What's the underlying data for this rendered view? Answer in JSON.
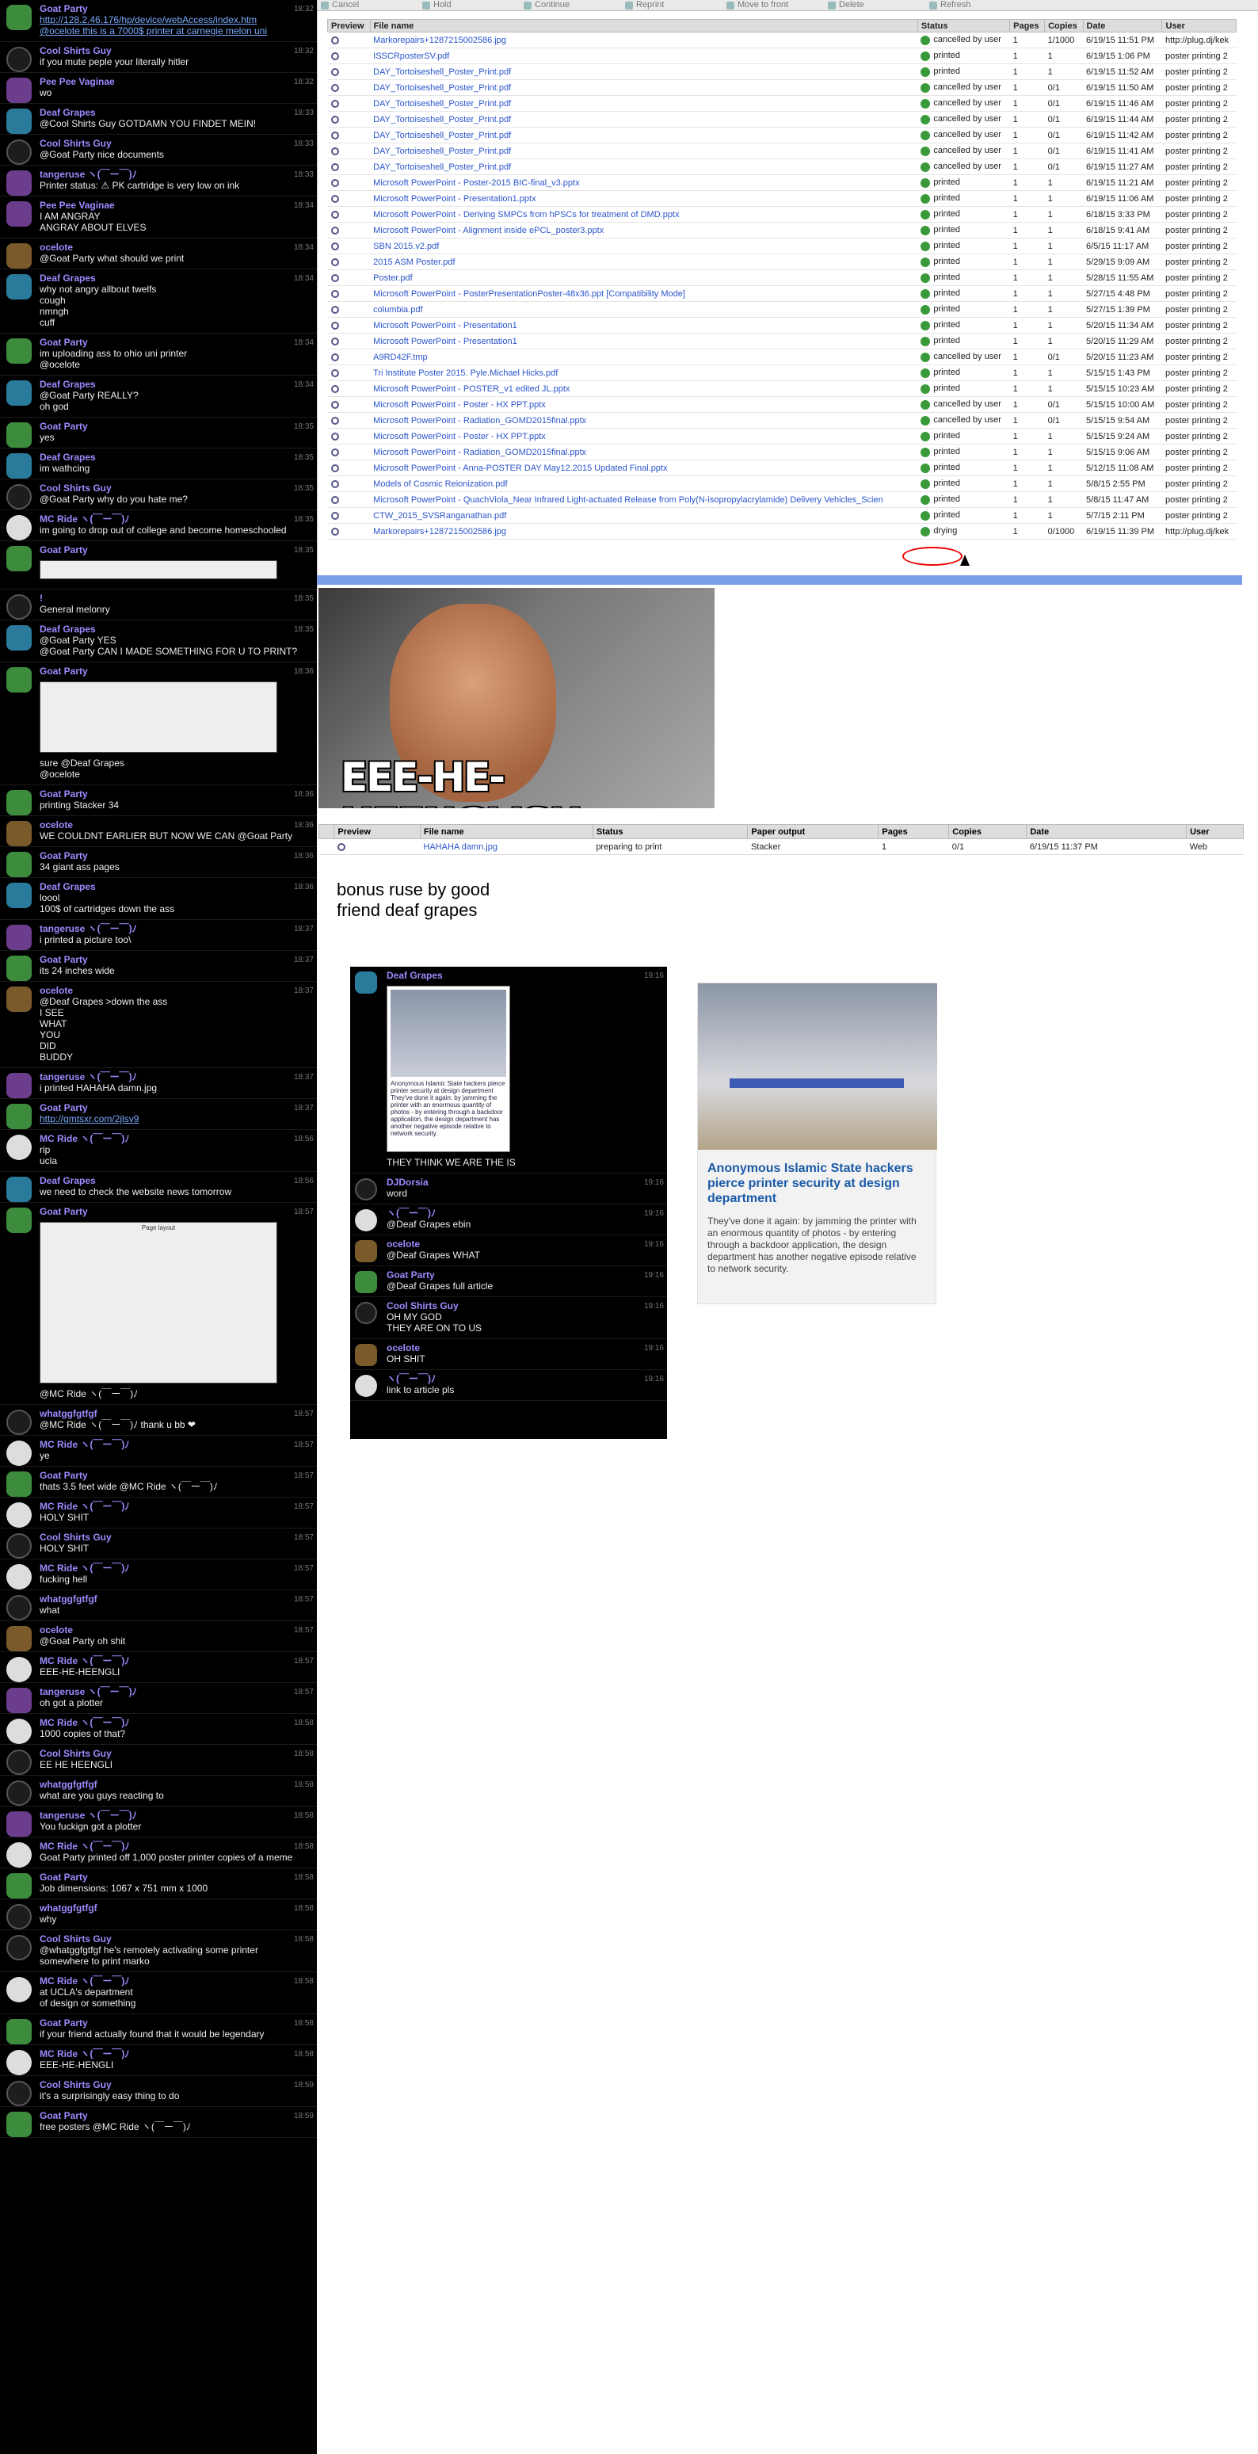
{
  "chat_messages": [
    {
      "user": "Goat Party",
      "time": "18:32",
      "text": "http://128.2.46.176/hp/device/webAccess/index.htm\n@ocelote this is a 7000$ printer at carnegie melon uni",
      "av": "c1"
    },
    {
      "user": "Cool Shirts Guy",
      "time": "18:32",
      "text": "if you mute peple your literally hitler",
      "av": "c4"
    },
    {
      "user": "Pee Pee Vaginae",
      "time": "18:32",
      "text": "wo",
      "av": "c3"
    },
    {
      "user": "Deaf Grapes",
      "time": "18:33",
      "text": "@Cool Shirts Guy GOTDAMN YOU FINDET MEIN!",
      "av": "c2"
    },
    {
      "user": "Cool Shirts Guy",
      "time": "18:33",
      "text": "@Goat Party nice documents",
      "av": "c4"
    },
    {
      "user": "tangeruse ヽ(￣ー￣)ﾉ",
      "time": "18:33",
      "text": "Printer status: ⚠ PK cartridge is very low on ink",
      "av": "c3"
    },
    {
      "user": "Pee Pee Vaginae",
      "time": "18:34",
      "text": "I AM ANGRAY\nANGRAY ABOUT ELVES",
      "av": "c3"
    },
    {
      "user": "ocelote",
      "time": "18:34",
      "text": "@Goat Party what should we print",
      "av": "c6"
    },
    {
      "user": "Deaf Grapes",
      "time": "18:34",
      "text": "why not angry allbout twelfs\ncough\nnmngh\ncuff",
      "av": "c2"
    },
    {
      "user": "Goat Party",
      "time": "18:34",
      "text": "im uploading ass to ohio uni printer\n@ocelote",
      "av": "c1"
    },
    {
      "user": "Deaf Grapes",
      "time": "18:34",
      "text": "@Goat Party REALLY?\noh god",
      "av": "c2"
    },
    {
      "user": "Goat Party",
      "time": "18:35",
      "text": "yes",
      "av": "c1"
    },
    {
      "user": "Deaf Grapes",
      "time": "18:35",
      "text": "im wathcing",
      "av": "c2"
    },
    {
      "user": "Cool Shirts Guy",
      "time": "18:35",
      "text": "@Goat Party why do you hate me?",
      "av": "c4"
    },
    {
      "user": "MC Ride ヽ(￣ー￣)ﾉ",
      "time": "18:35",
      "text": "im going to drop out of college and become homeschooled",
      "av": "c5"
    },
    {
      "user": "Goat Party",
      "time": "18:35",
      "text": "",
      "av": "c1",
      "img": 24
    },
    {
      "user": "!",
      "time": "18:35",
      "text": "General melonry",
      "av": "c4"
    },
    {
      "user": "Deaf Grapes",
      "time": "18:35",
      "text": "@Goat Party YES\n@Goat Party CAN I MADE SOMETHING FOR U TO PRINT?",
      "av": "c2"
    },
    {
      "user": "Goat Party",
      "time": "18:36",
      "text": "sure @Deaf Grapes\n@ocelote",
      "av": "c1",
      "img": 90
    },
    {
      "user": "Goat Party",
      "time": "18:36",
      "text": "printing Stacker 34",
      "av": "c1"
    },
    {
      "user": "ocelote",
      "time": "18:36",
      "text": "WE COULDNT EARLIER BUT NOW WE CAN @Goat Party",
      "av": "c6"
    },
    {
      "user": "Goat Party",
      "time": "18:36",
      "text": "34 giant ass pages",
      "av": "c1"
    },
    {
      "user": "Deaf Grapes",
      "time": "18:36",
      "text": "loool\n100$ of cartridges down the ass",
      "av": "c2"
    },
    {
      "user": "tangeruse ヽ(￣ー￣)ﾉ",
      "time": "18:37",
      "text": "i printed a picture too\\",
      "av": "c3"
    },
    {
      "user": "Goat Party",
      "time": "18:37",
      "text": "its 24 inches wide",
      "av": "c1"
    },
    {
      "user": "ocelote",
      "time": "18:37",
      "text": "@Deaf Grapes >down the ass\nI SEE\nWHAT\nYOU\nDID\nBUDDY",
      "av": "c6"
    },
    {
      "user": "tangeruse ヽ(￣ー￣)ﾉ",
      "time": "18:37",
      "text": "i printed HAHAHA damn.jpg",
      "av": "c3"
    },
    {
      "user": "Goat Party",
      "time": "18:37",
      "text": "http://gmtsxr.com/2jlsv9",
      "av": "c1"
    },
    {
      "user": "MC Ride ヽ(￣ー￣)ﾉ",
      "time": "18:56",
      "text": "rip\nucla",
      "av": "c5"
    },
    {
      "user": "Deaf Grapes",
      "time": "18:56",
      "text": "we need to check the website news tomorrow",
      "av": "c2"
    },
    {
      "user": "Goat Party",
      "time": "18:57",
      "text": "@MC Ride ヽ(￣ー￣)ﾉ",
      "av": "c1",
      "img": 204,
      "imgcap": "Page layout"
    },
    {
      "user": "whatggfgtfgf",
      "time": "18:57",
      "text": "@MC Ride ヽ(￣ー￣)ﾉ thank u bb ❤",
      "av": "c4"
    },
    {
      "user": "MC Ride ヽ(￣ー￣)ﾉ",
      "time": "18:57",
      "text": "ye",
      "av": "c5"
    },
    {
      "user": "Goat Party",
      "time": "18:57",
      "text": "thats 3.5 feet wide @MC Ride ヽ(￣ー￣)ﾉ",
      "av": "c1"
    },
    {
      "user": "MC Ride ヽ(￣ー￣)ﾉ",
      "time": "18:57",
      "text": "HOLY SHIT",
      "av": "c5"
    },
    {
      "user": "Cool Shirts Guy",
      "time": "18:57",
      "text": "HOLY SHIT",
      "av": "c4"
    },
    {
      "user": "MC Ride ヽ(￣ー￣)ﾉ",
      "time": "18:57",
      "text": "fucking hell",
      "av": "c5"
    },
    {
      "user": "whatggfgtfgf",
      "time": "18:57",
      "text": "what",
      "av": "c4"
    },
    {
      "user": "ocelote",
      "time": "18:57",
      "text": "@Goat Party oh shit",
      "av": "c6"
    },
    {
      "user": "MC Ride ヽ(￣ー￣)ﾉ",
      "time": "18:57",
      "text": "EEE-HE-HEENGLI",
      "av": "c5"
    },
    {
      "user": "tangeruse ヽ(￣ー￣)ﾉ",
      "time": "18:57",
      "text": "oh got a plotter",
      "av": "c3"
    },
    {
      "user": "MC Ride ヽ(￣ー￣)ﾉ",
      "time": "18:58",
      "text": "1000 copies of that?",
      "av": "c5"
    },
    {
      "user": "Cool Shirts Guy",
      "time": "18:58",
      "text": "EE HE HEENGLI",
      "av": "c4"
    },
    {
      "user": "whatggfgtfgf",
      "time": "18:58",
      "text": "what are you guys reacting to",
      "av": "c4"
    },
    {
      "user": "tangeruse ヽ(￣ー￣)ﾉ",
      "time": "18:58",
      "text": "You fuckign got a plotter",
      "av": "c3"
    },
    {
      "user": "MC Ride ヽ(￣ー￣)ﾉ",
      "time": "18:58",
      "text": "Goat Party printed off 1,000 poster printer copies of a meme",
      "av": "c5"
    },
    {
      "user": "Goat Party",
      "time": "18:58",
      "text": "Job dimensions: 1067 x 751 mm x 1000",
      "av": "c1"
    },
    {
      "user": "whatggfgtfgf",
      "time": "18:58",
      "text": "why",
      "av": "c4"
    },
    {
      "user": "Cool Shirts Guy",
      "time": "18:58",
      "text": "@whatggfgtfgf he's remotely activating some printer\nsomewhere to print marko",
      "av": "c4"
    },
    {
      "user": "MC Ride ヽ(￣ー￣)ﾉ",
      "time": "18:58",
      "text": "at UCLA's department\nof design or something",
      "av": "c5"
    },
    {
      "user": "Goat Party",
      "time": "18:58",
      "text": "if your friend actually found that it would be legendary",
      "av": "c1"
    },
    {
      "user": "MC Ride ヽ(￣ー￣)ﾉ",
      "time": "18:58",
      "text": "EEE-HE-HENGLI",
      "av": "c5"
    },
    {
      "user": "Cool Shirts Guy",
      "time": "18:59",
      "text": "it's a surprisingly easy thing to do",
      "av": "c4"
    },
    {
      "user": "Goat Party",
      "time": "18:59",
      "text": "free posters @MC Ride ヽ(￣ー￣)ﾉ",
      "av": "c1"
    }
  ],
  "toolbar": [
    "Cancel",
    "Hold",
    "Continue",
    "Reprint",
    "Move to front",
    "Delete",
    "Refresh"
  ],
  "jobs_headers": [
    "Preview",
    "File name",
    "Status",
    "Pages",
    "Copies",
    "Date",
    "User"
  ],
  "jobs": [
    [
      "Markorepairs+1287215002586.jpg",
      "cancelled by user",
      "1",
      "1/1000",
      "6/19/15 11:51 PM",
      "http://plug.dj/kek"
    ],
    [
      "ISSCRposterSV.pdf",
      "printed",
      "1",
      "1",
      "6/19/15 1:06 PM",
      "poster printing 2"
    ],
    [
      "DAY_Tortoiseshell_Poster_Print.pdf",
      "printed",
      "1",
      "1",
      "6/19/15 11:52 AM",
      "poster printing 2"
    ],
    [
      "DAY_Tortoiseshell_Poster_Print.pdf",
      "cancelled by user",
      "1",
      "0/1",
      "6/19/15 11:50 AM",
      "poster printing 2"
    ],
    [
      "DAY_Tortoiseshell_Poster_Print.pdf",
      "cancelled by user",
      "1",
      "0/1",
      "6/19/15 11:46 AM",
      "poster printing 2"
    ],
    [
      "DAY_Tortoiseshell_Poster_Print.pdf",
      "cancelled by user",
      "1",
      "0/1",
      "6/19/15 11:44 AM",
      "poster printing 2"
    ],
    [
      "DAY_Tortoiseshell_Poster_Print.pdf",
      "cancelled by user",
      "1",
      "0/1",
      "6/19/15 11:42 AM",
      "poster printing 2"
    ],
    [
      "DAY_Tortoiseshell_Poster_Print.pdf",
      "cancelled by user",
      "1",
      "0/1",
      "6/19/15 11:41 AM",
      "poster printing 2"
    ],
    [
      "DAY_Tortoiseshell_Poster_Print.pdf",
      "cancelled by user",
      "1",
      "0/1",
      "6/19/15 11:27 AM",
      "poster printing 2"
    ],
    [
      "Microsoft PowerPoint - Poster-2015 BIC-final_v3.pptx",
      "printed",
      "1",
      "1",
      "6/19/15 11:21 AM",
      "poster printing 2"
    ],
    [
      "Microsoft PowerPoint - Presentation1.pptx",
      "printed",
      "1",
      "1",
      "6/19/15 11:06 AM",
      "poster printing 2"
    ],
    [
      "Microsoft PowerPoint - Deriving SMPCs from hPSCs for treatment of DMD.pptx",
      "printed",
      "1",
      "1",
      "6/18/15 3:33 PM",
      "poster printing 2"
    ],
    [
      "Microsoft PowerPoint - Alignment inside ePCL_poster3.pptx",
      "printed",
      "1",
      "1",
      "6/18/15 9:41 AM",
      "poster printing 2"
    ],
    [
      "SBN 2015.v2.pdf",
      "printed",
      "1",
      "1",
      "6/5/15 11:17 AM",
      "poster printing 2"
    ],
    [
      "2015 ASM Poster.pdf",
      "printed",
      "1",
      "1",
      "5/29/15 9:09 AM",
      "poster printing 2"
    ],
    [
      "Poster.pdf",
      "printed",
      "1",
      "1",
      "5/28/15 11:55 AM",
      "poster printing 2"
    ],
    [
      "Microsoft PowerPoint - PosterPresentationPoster-48x36.ppt [Compatibility Mode]",
      "printed",
      "1",
      "1",
      "5/27/15 4:48 PM",
      "poster printing 2"
    ],
    [
      "columbia.pdf",
      "printed",
      "1",
      "1",
      "5/27/15 1:39 PM",
      "poster printing 2"
    ],
    [
      "Microsoft PowerPoint - Presentation1",
      "printed",
      "1",
      "1",
      "5/20/15 11:34 AM",
      "poster printing 2"
    ],
    [
      "Microsoft PowerPoint - Presentation1",
      "printed",
      "1",
      "1",
      "5/20/15 11:29 AM",
      "poster printing 2"
    ],
    [
      "A9RD42F.tmp",
      "cancelled by user",
      "1",
      "0/1",
      "5/20/15 11:23 AM",
      "poster printing 2"
    ],
    [
      "Tri Institute Poster 2015. Pyle.Michael Hicks.pdf",
      "printed",
      "1",
      "1",
      "5/15/15 1:43 PM",
      "poster printing 2"
    ],
    [
      "Microsoft PowerPoint - POSTER_v1 edited JL.pptx",
      "printed",
      "1",
      "1",
      "5/15/15 10:23 AM",
      "poster printing 2"
    ],
    [
      "Microsoft PowerPoint - Poster - HX PPT.pptx",
      "cancelled by user",
      "1",
      "0/1",
      "5/15/15 10:00 AM",
      "poster printing 2"
    ],
    [
      "Microsoft PowerPoint - Radiation_GOMD2015final.pptx",
      "cancelled by user",
      "1",
      "0/1",
      "5/15/15 9:54 AM",
      "poster printing 2"
    ],
    [
      "Microsoft PowerPoint - Poster - HX PPT.pptx",
      "printed",
      "1",
      "1",
      "5/15/15 9:24 AM",
      "poster printing 2"
    ],
    [
      "Microsoft PowerPoint - Radiation_GOMD2015final.pptx",
      "printed",
      "1",
      "1",
      "5/15/15 9:06 AM",
      "poster printing 2"
    ],
    [
      "Microsoft PowerPoint - Anna-POSTER DAY May12.2015 Updated Final.pptx",
      "printed",
      "1",
      "1",
      "5/12/15 11:08 AM",
      "poster printing 2"
    ],
    [
      "Models of Cosmic Reionization.pdf",
      "printed",
      "1",
      "1",
      "5/8/15 2:55 PM",
      "poster printing 2"
    ],
    [
      "Microsoft PowerPoint - QuachViola_Near Infrared Light-actuated Release from Poly(N-isopropylacrylamide) Delivery Vehicles_Scien",
      "printed",
      "1",
      "1",
      "5/8/15 11:47 AM",
      "poster printing 2"
    ],
    [
      "CTW_2015_SVSRanganathan.pdf",
      "printed",
      "1",
      "1",
      "5/7/15 2:11 PM",
      "poster printing 2"
    ],
    [
      "Markorepairs+1287215002586.jpg",
      "drying",
      "1",
      "0/1000",
      "6/19/15 11:39 PM",
      "http://plug.dj/kek"
    ]
  ],
  "meme_caption": "EEE-HE-HEENGLISH",
  "queue2_headers": [
    "Preview",
    "File name",
    "Status",
    "Paper output",
    "Pages",
    "Copies",
    "Date",
    "User"
  ],
  "queue2_row": [
    "HAHAHA damn.jpg",
    "preparing to print",
    "Stacker",
    "1",
    "0/1",
    "6/19/15 11:37 PM",
    "Web"
  ],
  "caption": "bonus ruse by good\nfriend deaf grapes",
  "inset_messages": [
    {
      "user": "Deaf Grapes",
      "time": "19:16",
      "text": "THEY THINK WE ARE THE IS",
      "av": "c2",
      "thumb": true
    },
    {
      "user": "DJDorsia",
      "time": "19:16",
      "text": "word",
      "av": "c4"
    },
    {
      "user": "ヽ(￣ー￣)ﾉ",
      "time": "19:16",
      "text": "@Deaf Grapes ebin",
      "av": "c5"
    },
    {
      "user": "ocelote",
      "time": "19:16",
      "text": "@Deaf Grapes WHAT",
      "av": "c6"
    },
    {
      "user": "Goat Party",
      "time": "19:16",
      "text": "@Deaf Grapes full article",
      "av": "c1"
    },
    {
      "user": "Cool Shirts Guy",
      "time": "19:16",
      "text": "OH MY GOD\nTHEY ARE ON TO US",
      "av": "c4"
    },
    {
      "user": "ocelote",
      "time": "19:16",
      "text": "OH SHIT",
      "av": "c6"
    },
    {
      "user": "ヽ(￣ー￣)ﾉ",
      "time": "19:16",
      "text": "link to article pls",
      "av": "c5"
    }
  ],
  "article": {
    "title": "Anonymous Islamic State hackers pierce printer security at design department",
    "desc": "They've done it again: by jamming the printer with an enormous quantity of photos - by entering through a backdoor application, the design department has another negative episode relative to network security.",
    "thumb_title": "Anonymous Islamic State hackers pierce printer security at design department",
    "thumb_desc": "They've done it again: by jamming the printer with an enormous quantity of photos - by entering through a backdoor application, the design department has another negative episode relative to network security."
  }
}
